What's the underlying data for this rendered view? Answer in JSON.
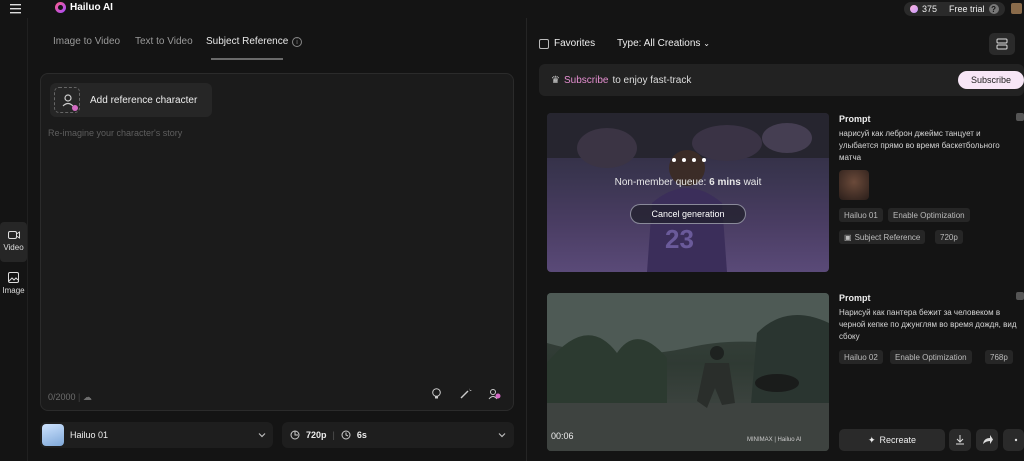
{
  "app": {
    "name": "Hailuo AI",
    "credits": "375",
    "plan": "Free trial"
  },
  "tabs": [
    {
      "label": "Image to Video",
      "active": false
    },
    {
      "label": "Text to Video",
      "active": false
    },
    {
      "label": "Subject Reference",
      "active": true
    }
  ],
  "rail": {
    "video": "Video",
    "image": "Image"
  },
  "prompt": {
    "add_reference": "Add reference character",
    "placeholder": "Re-imagine your character's story",
    "char_count": "0/2000"
  },
  "selectors": {
    "model": "Hailuo 01",
    "resolution": "720p",
    "duration": "6s"
  },
  "filters": {
    "favorites": "Favorites",
    "type_label": "Type:",
    "type_value": "All Creations"
  },
  "banner": {
    "link": "Subscribe",
    "text": "to enjoy fast-track",
    "button": "Subscribe"
  },
  "cards": [
    {
      "queue_prefix": "Non-member queue:",
      "queue_time": "6 mins",
      "queue_suffix": "wait",
      "cancel": "Cancel generation",
      "prompt_heading": "Prompt",
      "prompt_text": "нарисуй как леброн джеймс танцует и улыбается прямо во время баскетбольного матча",
      "tags": [
        "Hailuo 01",
        "Enable Optimization",
        "Subject Reference",
        "720p"
      ]
    },
    {
      "duration": "00:06",
      "watermark": "MINIMAX | Hailuo AI",
      "prompt_heading": "Prompt",
      "prompt_text": "Нарисуй как пантера бежит за человеком в черной кепке по джунглям во время дождя, вид сбоку",
      "tags": [
        "Hailuo 02",
        "Enable Optimization",
        "768p"
      ],
      "recreate": "Recreate"
    }
  ],
  "colors": {
    "accent_pink": "#e58fd0",
    "background": "#141414",
    "panel": "#1b1b1b"
  }
}
